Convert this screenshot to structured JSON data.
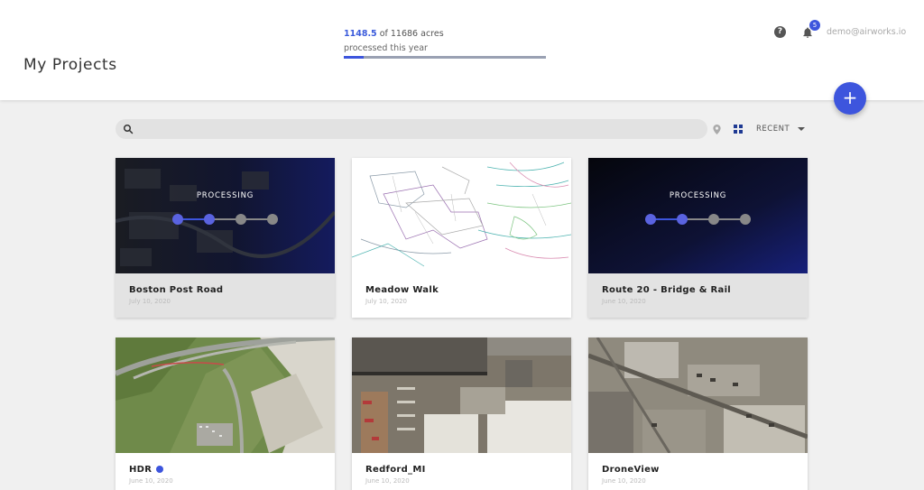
{
  "header": {
    "title": "My Projects",
    "acres_processed": "1148.5",
    "acres_total_text": "of 11686 acres",
    "acres_subtext": "processed this year",
    "progress_fraction": 0.098,
    "notification_count": "5",
    "user_email": "demo@airworks.io"
  },
  "actions": {
    "add_label": "+"
  },
  "toolbar": {
    "search_placeholder": "",
    "sort_label": "RECENT"
  },
  "cards": [
    {
      "name": "Boston Post Road",
      "date": "July 10, 2020",
      "status": "PROCESSING",
      "steps_done": 2,
      "steps_total": 4
    },
    {
      "name": "Meadow Walk",
      "date": "July 10, 2020"
    },
    {
      "name": "Route 20 - Bridge & Rail",
      "date": "June 10, 2020",
      "status": "PROCESSING",
      "steps_done": 2,
      "steps_total": 4
    },
    {
      "name": "HDR",
      "date": "June 10, 2020",
      "is_new": true
    },
    {
      "name": "Redford_MI",
      "date": "June 10, 2020"
    },
    {
      "name": "DroneView",
      "date": "June 10, 2020"
    }
  ],
  "colors": {
    "accent": "#3d55dd",
    "processing_bg": "#0d1030"
  }
}
